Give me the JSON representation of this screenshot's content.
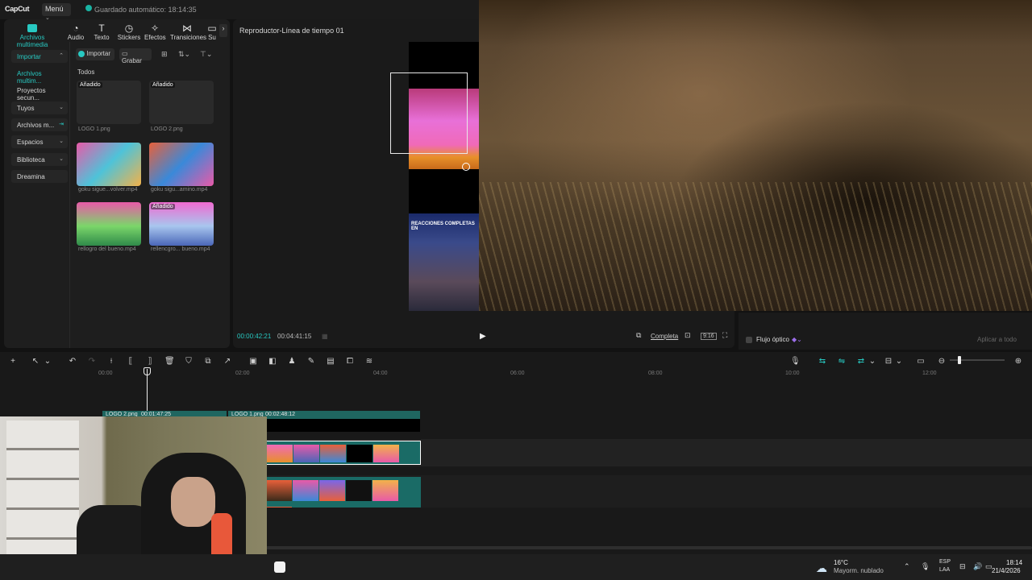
{
  "topbar": {
    "app_name": "CapCut",
    "menu_label": "Menú",
    "autosave": "Guardado automático: 18:14:35"
  },
  "media_tabs": [
    {
      "label": "Archivos multimedia",
      "icon": "media-icon",
      "active": true
    },
    {
      "label": "Audio",
      "icon": "audio-icon"
    },
    {
      "label": "Texto",
      "icon": "text-icon"
    },
    {
      "label": "Stickers",
      "icon": "sticker-icon"
    },
    {
      "label": "Efectos",
      "icon": "effects-icon"
    },
    {
      "label": "Transiciones",
      "icon": "transitions-icon"
    },
    {
      "label": "Su",
      "icon": "subtitles-icon"
    }
  ],
  "sidebar": {
    "items": [
      {
        "label": "Importar"
      },
      {
        "label": "Archivos multim..."
      },
      {
        "label": "Proyectos secun..."
      },
      {
        "label": "Tuyos"
      },
      {
        "label": "Archivos m..."
      },
      {
        "label": "Espacios"
      },
      {
        "label": "Biblioteca"
      },
      {
        "label": "Dreamina"
      }
    ]
  },
  "media": {
    "import_label": "Importar",
    "record_label": "Grabar",
    "filter_label": "Todos",
    "items": [
      {
        "name": "LOGO 1.png",
        "badge": "Añadido"
      },
      {
        "name": "LOGO 2.png",
        "badge": "Añadido"
      },
      {
        "name": "goku sigue...volver.mp4",
        "badge": ""
      },
      {
        "name": "goku sigu...amino.mp4",
        "badge": ""
      },
      {
        "name": "rellogro del bueno.mp4",
        "badge": ""
      },
      {
        "name": "rellencgro... bueno.mp4",
        "badge": "Añadido"
      }
    ]
  },
  "player": {
    "title": "Reproductor-Línea de tiempo 01",
    "overlay_text": "REACCIONES COMPLETAS EN",
    "current_time": "00:00:42:21",
    "total_time": "00:04:41:15",
    "quality_label": "Completa",
    "ratio_label": "9:16"
  },
  "properties": {
    "optical_flow_label": "Flujo óptico",
    "apply_all_label": "Aplicar a todo"
  },
  "timeline": {
    "ticks": [
      "00:00",
      "02:00",
      "04:00",
      "06:00",
      "08:00",
      "10:00",
      "12:00"
    ],
    "clips": [
      {
        "name": "LOGO 2.png",
        "duration": "00:01:47:25"
      },
      {
        "name": "LOGO 1.png",
        "duration": "00:02:48:12"
      }
    ]
  },
  "taskbar": {
    "temperature": "16°C",
    "weather": "Mayorm. nublado",
    "lang_top": "ESP",
    "lang_bottom": "LAA",
    "time": "18:14",
    "date": "21/4/2026"
  },
  "colors": {
    "accent": "#28c9c2",
    "clip_teal": "#1a6b66"
  }
}
